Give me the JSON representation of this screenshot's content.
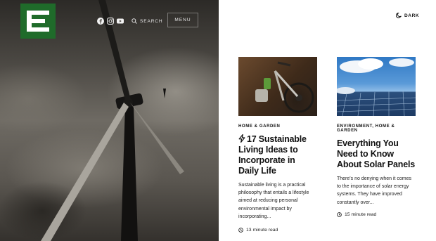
{
  "header": {
    "logo": {
      "icon": "logo-mark-e",
      "accent": "#1f6b2a"
    },
    "social": [
      {
        "icon": "facebook-icon"
      },
      {
        "icon": "instagram-icon"
      },
      {
        "icon": "youtube-icon"
      }
    ],
    "search_label": "SEARCH",
    "menu_label": "MENU",
    "dark_toggle_label": "DARK"
  },
  "articles": [
    {
      "category": "HOME & GARDEN",
      "title": "17 Sustainable Living Ideas to Incorporate in Daily Life",
      "title_icon": "bolt-icon",
      "excerpt": "Sustainable living is a practical philosophy that entails a lifestyle aimed at reducing personal environmental impact by incorporating...",
      "read_time": "13 minute read"
    },
    {
      "category": "ENVIRONMENT, HOME & GARDEN",
      "title": "Everything You Need to Know About Solar Panels",
      "excerpt": "There's no denying when it comes to the importance of solar energy systems. They have improved constantly over...",
      "read_time": "15 minute read"
    }
  ]
}
